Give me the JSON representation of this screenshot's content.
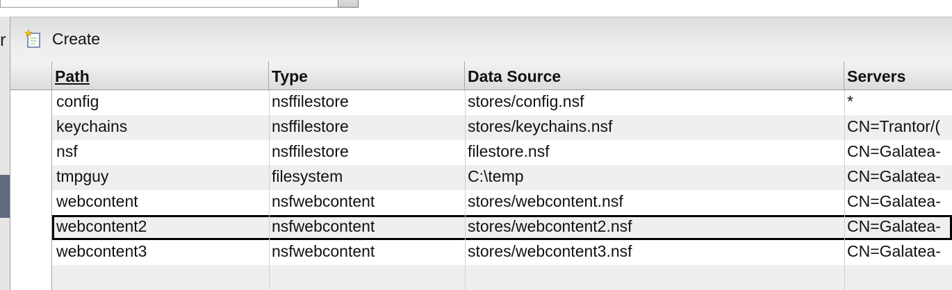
{
  "left_fragment": "r",
  "toolbar": {
    "create_label": "Create",
    "create_icon": "new-item-icon"
  },
  "table": {
    "columns": [
      "Path",
      "Type",
      "Data Source",
      "Servers"
    ],
    "sorted_column": "Path",
    "rows": [
      {
        "path": "config",
        "type": "nsffilestore",
        "data_source": "stores/config.nsf",
        "servers": "*"
      },
      {
        "path": "keychains",
        "type": "nsffilestore",
        "data_source": "stores/keychains.nsf",
        "servers": "CN=Trantor/("
      },
      {
        "path": "nsf",
        "type": "nsffilestore",
        "data_source": "filestore.nsf",
        "servers": "CN=Galatea-"
      },
      {
        "path": "tmpguy",
        "type": "filesystem",
        "data_source": "C:\\temp",
        "servers": "CN=Galatea-"
      },
      {
        "path": "webcontent",
        "type": "nsfwebcontent",
        "data_source": "stores/webcontent.nsf",
        "servers": "CN=Galatea-"
      },
      {
        "path": "webcontent2",
        "type": "nsfwebcontent",
        "data_source": "stores/webcontent2.nsf",
        "servers": "CN=Galatea-"
      },
      {
        "path": "webcontent3",
        "type": "nsfwebcontent",
        "data_source": "stores/webcontent3.nsf",
        "servers": "CN=Galatea-"
      }
    ],
    "focused_row": 5
  },
  "colors": {
    "toolbar_bg": "#e4e4e4",
    "alt_row": "#efefef",
    "focus_outline": "#000000",
    "left_accent": "#5f6b80"
  }
}
